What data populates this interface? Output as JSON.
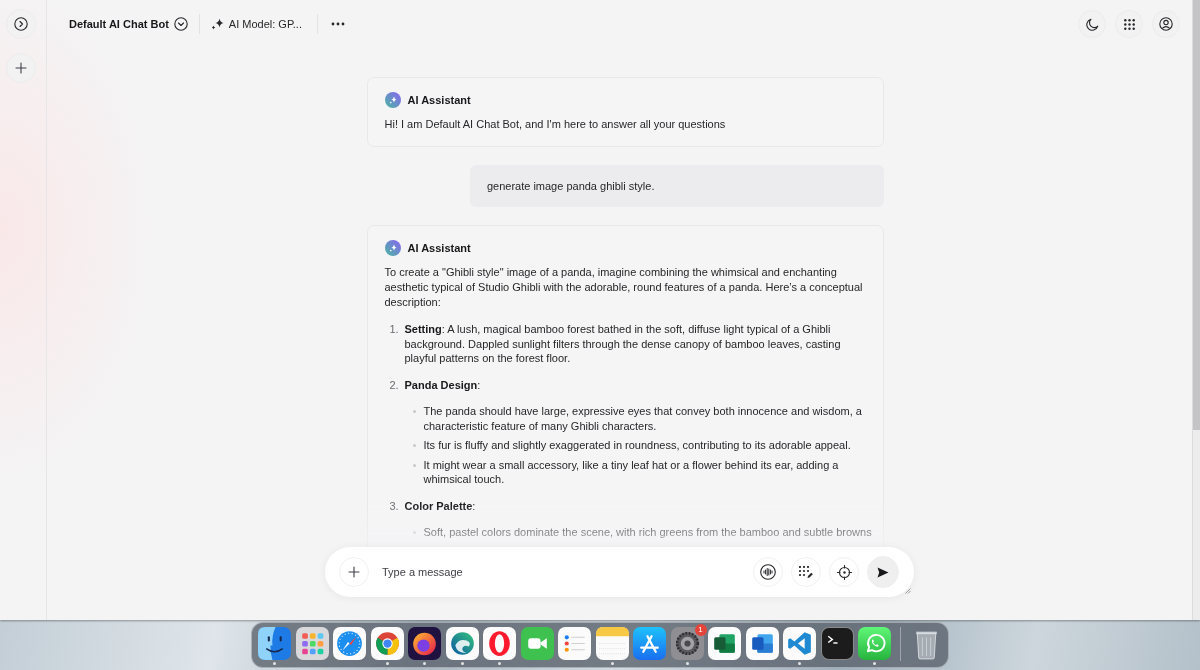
{
  "header": {
    "bot_name": "Default AI Chat Bot",
    "model": "AI Model: GP..."
  },
  "messages": [
    {
      "kind": "assistant",
      "sender": "AI Assistant",
      "paragraphs": [
        "Hi! I am Default AI Chat Bot, and I'm here to answer all your questions"
      ]
    },
    {
      "kind": "user",
      "text": "generate image panda ghibli style."
    },
    {
      "kind": "assistant",
      "sender": "AI Assistant",
      "paragraphs": [
        "To create a \"Ghibli style\" image of a panda, imagine combining the whimsical and enchanting aesthetic typical of Studio Ghibli with the adorable, round features of a panda. Here’s a conceptual description:"
      ],
      "list": [
        {
          "number": "1.",
          "text": "**Setting**: A lush, magical bamboo forest bathed in the soft, diffuse light typical of a Ghibli background. Dappled sunlight filters through the dense canopy of bamboo leaves, casting playful patterns on the forest floor."
        },
        {
          "number": "2.",
          "text": "**Panda Design**:",
          "bullets": [
            "The panda should have large, expressive eyes that convey both innocence and wisdom, a characteristic feature of many Ghibli characters.",
            "Its fur is fluffy and slightly exaggerated in roundness, contributing to its adorable appeal.",
            "It might wear a small accessory, like a tiny leaf hat or a flower behind its ear, adding a whimsical touch."
          ]
        },
        {
          "number": "3.",
          "text": "**Color Palette**:",
          "bullets": [
            "Soft, pastel colors dominate the scene, with rich greens from the bamboo and subtle browns"
          ]
        }
      ]
    }
  ],
  "composer": {
    "placeholder": "Type a message"
  },
  "dock": {
    "apps": [
      {
        "kind": "finder",
        "running": true
      },
      {
        "kind": "launchpad",
        "running": false
      },
      {
        "kind": "safari",
        "running": false
      },
      {
        "kind": "chrome",
        "running": true
      },
      {
        "kind": "firefox",
        "running": true
      },
      {
        "kind": "edge",
        "running": true
      },
      {
        "kind": "opera",
        "running": true
      },
      {
        "kind": "facetime",
        "running": false
      },
      {
        "kind": "reminders",
        "running": false
      },
      {
        "kind": "notes",
        "running": true
      },
      {
        "kind": "appstore",
        "running": false
      },
      {
        "kind": "settings",
        "running": true,
        "badge": "1"
      },
      {
        "kind": "excel",
        "running": false
      },
      {
        "kind": "word",
        "running": false
      },
      {
        "kind": "vscode",
        "running": true
      },
      {
        "kind": "terminal",
        "running": false
      },
      {
        "kind": "whatsapp",
        "running": true
      }
    ]
  }
}
